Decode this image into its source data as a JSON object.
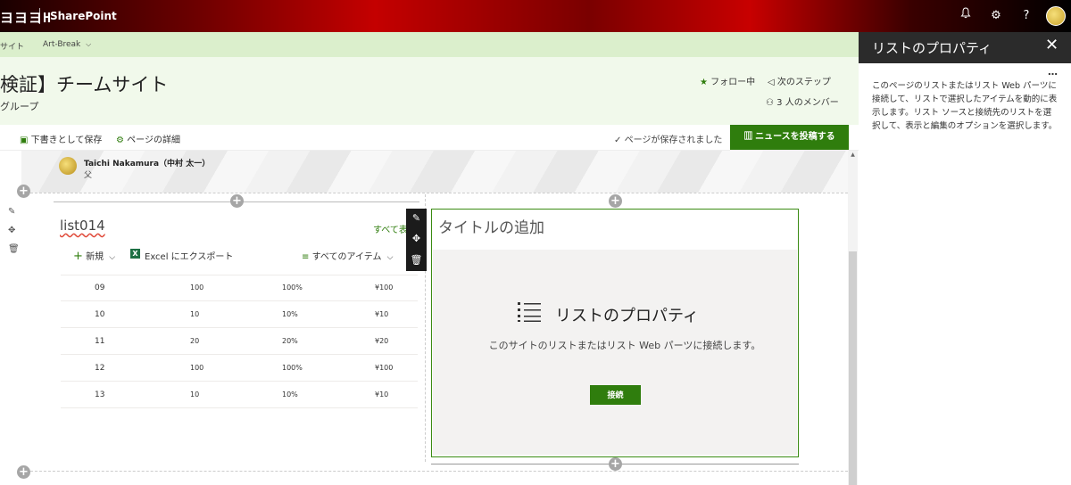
{
  "suitebar": {
    "brand": "ヨヨヨH",
    "app_name": "SharePoint",
    "icons": [
      "bell-icon",
      "gear-icon",
      "help-icon"
    ]
  },
  "hubnav": {
    "items": [
      "サイト",
      "Art-Break"
    ]
  },
  "site": {
    "title": "検証】チームサイト",
    "subtitle": "グループ",
    "follow_label": "フォロー中",
    "next_step_label": "次のステップ",
    "members_label": "3 人のメンバー"
  },
  "commandbar": {
    "save_draft": "下書きとして保存",
    "page_details": "ページの詳細",
    "saved_status": "ページが保存されました",
    "post_news": "ニュースを投稿する"
  },
  "author": {
    "name": "Taichi Nakamura（中村 太一）",
    "role": "父"
  },
  "list": {
    "title": "list014",
    "see_all": "すべて表示",
    "new_label": "新規",
    "export_label": "Excel にエクスポート",
    "view_label": "すべてのアイテム",
    "rows": [
      [
        "09",
        "100",
        "100%",
        "¥100"
      ],
      [
        "10",
        "10",
        "10%",
        "¥10"
      ],
      [
        "11",
        "20",
        "20%",
        "¥20"
      ],
      [
        "12",
        "100",
        "100%",
        "¥100"
      ],
      [
        "13",
        "10",
        "10%",
        "¥10"
      ]
    ]
  },
  "right_webpart": {
    "add_title": "タイトルの追加",
    "placeholder_title": "リストのプロパティ",
    "placeholder_desc": "このサイトのリストまたはリスト Web パーツに接続します。",
    "connect_label": "接続"
  },
  "pane": {
    "title": "リストのプロパティ",
    "description": "このページのリストまたはリスト Web パーツに接続して、リストで選択したアイテムを動的に表示します。リスト ソースと接続先のリストを選択して、表示と編集のオプションを選択します。"
  },
  "colors": {
    "accent": "#2f7d0d",
    "hub_bg": "#dbefcc",
    "header_bg": "#f1f9eb",
    "pane_header": "#2b2b2b"
  }
}
